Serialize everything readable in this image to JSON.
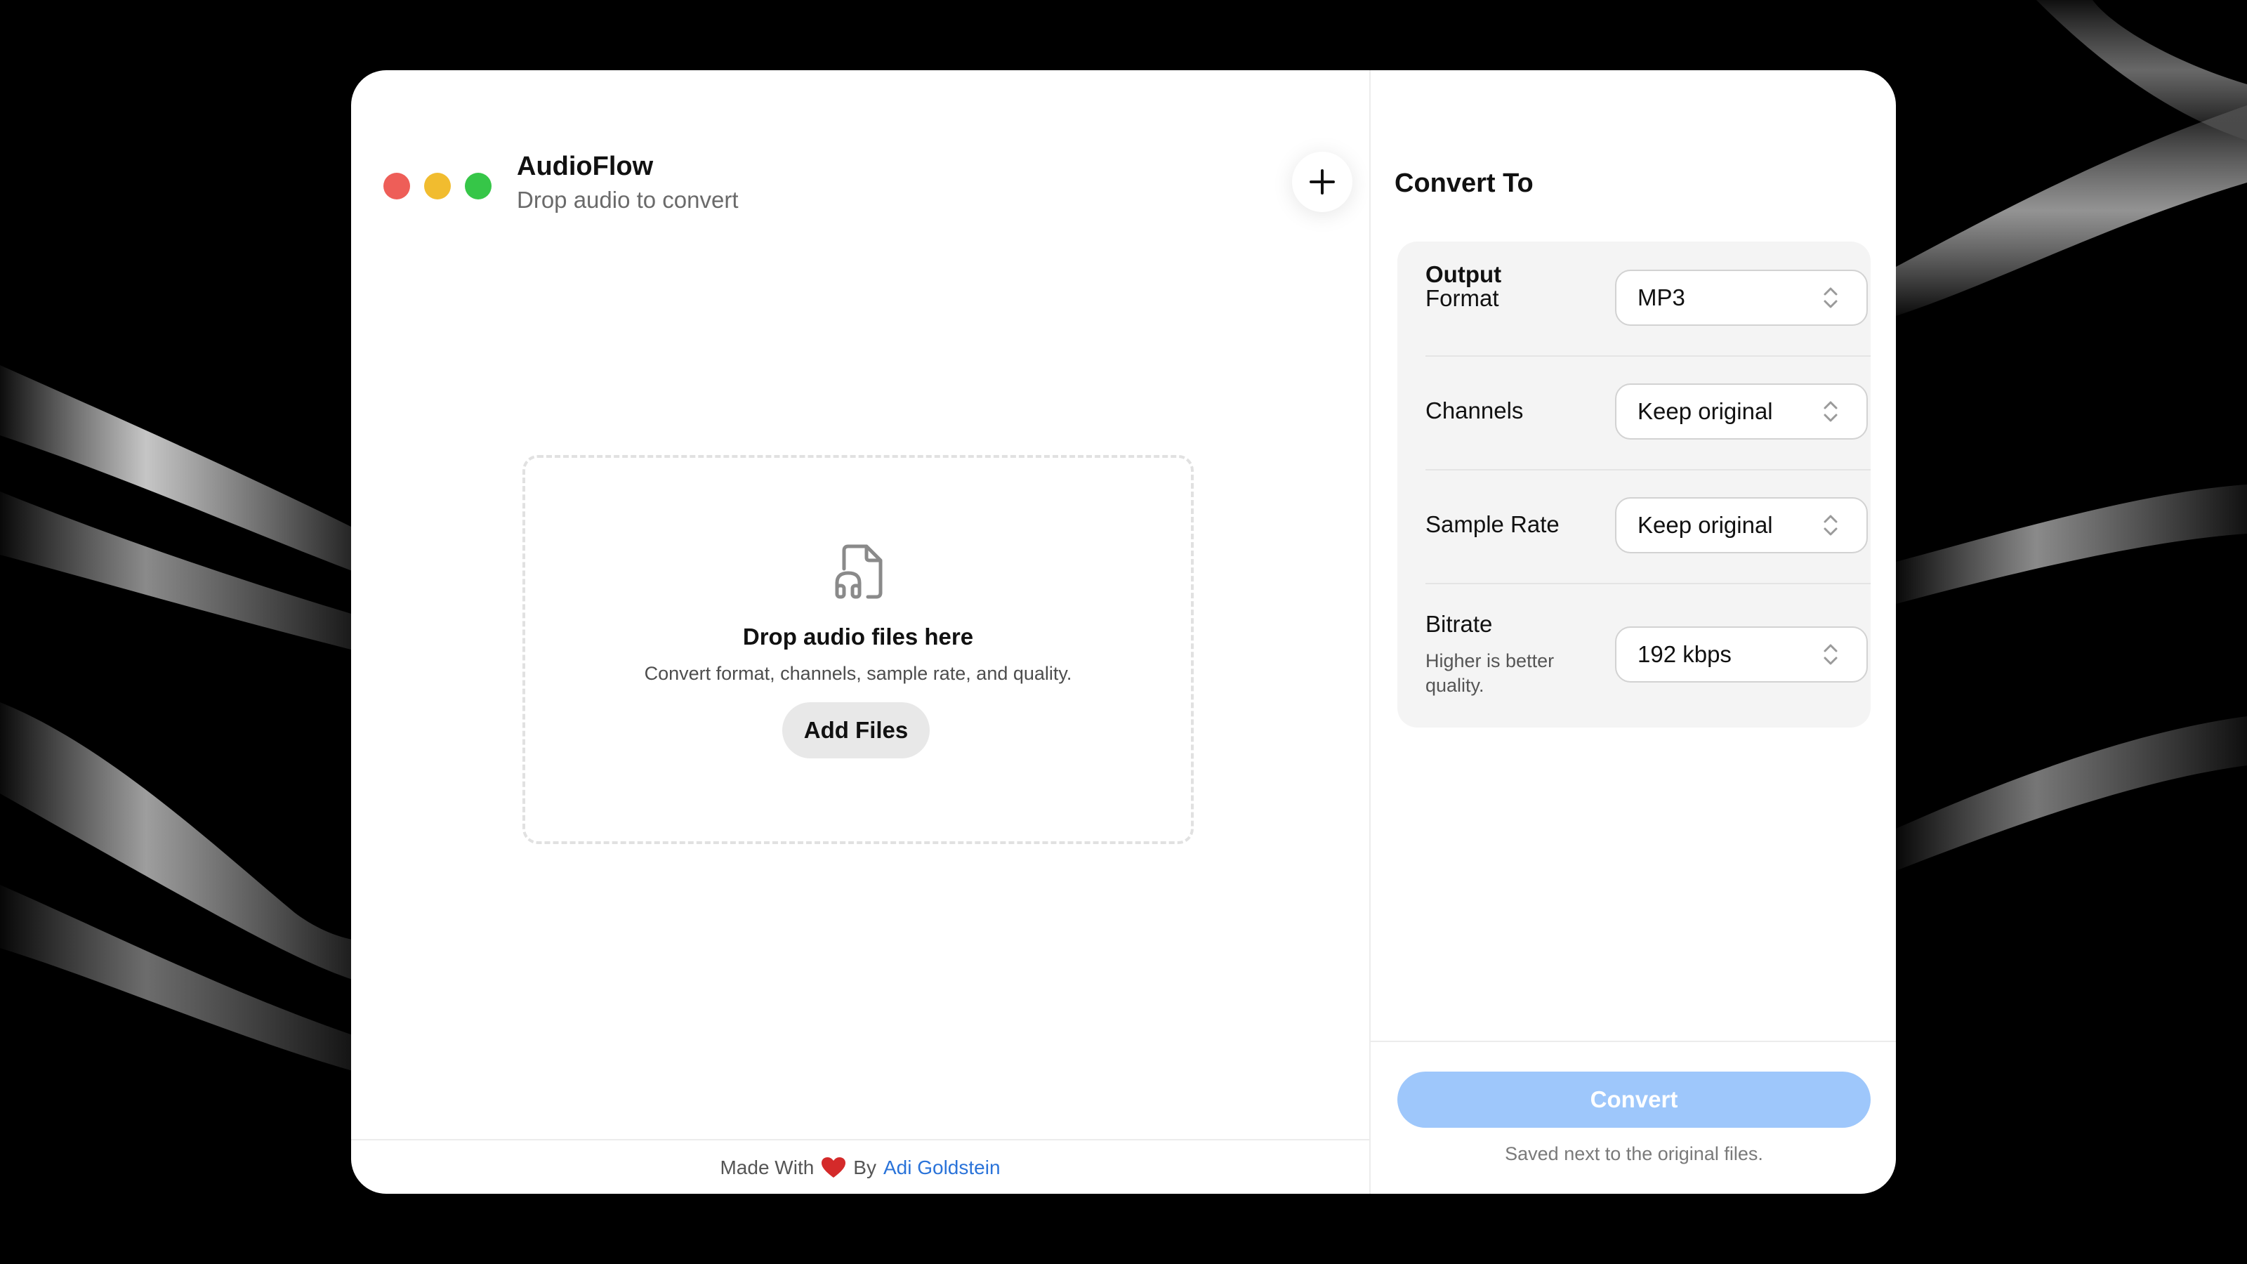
{
  "app": {
    "title": "AudioFlow",
    "subtitle": "Drop audio to convert"
  },
  "toolbar": {
    "add_icon": "plus-icon"
  },
  "dropzone": {
    "icon": "audio-file-icon",
    "title": "Drop audio files here",
    "subtitle": "Convert format, channels, sample rate, and quality.",
    "button_label": "Add Files"
  },
  "footer": {
    "made_with": "Made With",
    "heart_icon": "heart-icon",
    "by": "By",
    "author": "Adi Goldstein"
  },
  "panel": {
    "title": "Convert To",
    "section_label": "Output",
    "settings": [
      {
        "label": "Format",
        "value": "MP3"
      },
      {
        "label": "Channels",
        "value": "Keep original"
      },
      {
        "label": "Sample Rate",
        "value": "Keep original"
      },
      {
        "label": "Bitrate",
        "note": "Higher is better quality.",
        "value": "192 kbps"
      }
    ],
    "convert_label": "Convert",
    "saved_note": "Saved next to the original files."
  },
  "colors": {
    "accent_disabled": "#9ec7fb",
    "link": "#2a73d9",
    "traffic_red": "#ee5e58",
    "traffic_yellow": "#f1bc2f",
    "traffic_green": "#36c648",
    "heart": "#d42a2a"
  }
}
